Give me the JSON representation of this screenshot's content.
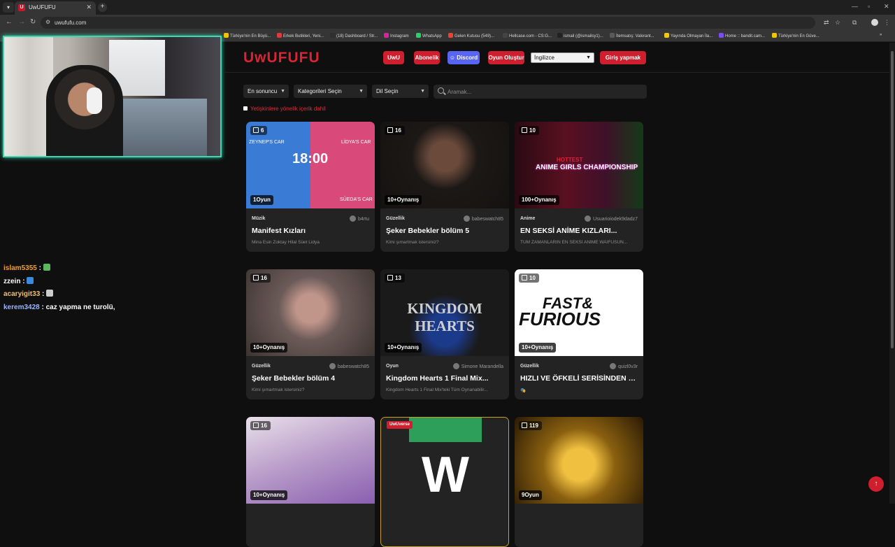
{
  "browser": {
    "tab_title": "UwUFUFU",
    "tab_favicon": "U",
    "url": "uwufufu.com",
    "bookmarks": [
      {
        "label": "Türkiye'nin En Büyü...",
        "color": "#f2c400"
      },
      {
        "label": "Erkek Butikleri, Yeni...",
        "color": "#e03a3a"
      },
      {
        "label": "(18) Dashboard / Str...",
        "color": "#2f2f2f"
      },
      {
        "label": "Instagram",
        "color": "#d6249f"
      },
      {
        "label": "WhatsApp",
        "color": "#25d366"
      },
      {
        "label": "Gelen Kutusu (549)...",
        "color": "#ea4335"
      },
      {
        "label": "Hellcase.com - CS:G...",
        "color": "#444444"
      },
      {
        "label": "ismail (@ismailsy1)...",
        "color": "#222222"
      },
      {
        "label": "İtemsatış: Valorant...",
        "color": "#5a5a5a"
      },
      {
        "label": "Yayında Olmayan İlа...",
        "color": "#f0c419"
      },
      {
        "label": "Home :: bandit.cam...",
        "color": "#7a4df0"
      },
      {
        "label": "Türkiye'nin En Güve...",
        "color": "#f2c400"
      }
    ]
  },
  "chat": [
    {
      "user": "islam5355",
      "color": "#f0a030",
      "message": ""
    },
    {
      "user": "zzein",
      "color": "#ffffff",
      "message": ""
    },
    {
      "user": "acaryigit33",
      "color": "#f0c070",
      "message": ""
    },
    {
      "user": "kerem3428",
      "color": "#9ab4ff",
      "message": "caz yapma ne turolü,"
    }
  ],
  "header": {
    "logo": "UwUFUFU",
    "buttons": [
      "UwU",
      "Abonelik",
      "Discord",
      "Oyun Oluştur"
    ],
    "language": "İngilizce",
    "login": "Giriş yapmak"
  },
  "filters": {
    "sort": "En sonuncu",
    "category": "Kategorileri Seçin",
    "language": "Dil Seçin",
    "search_placeholder": "Aramak..."
  },
  "nsfw_label": "Yetişkinlere yönelik içerik dahil",
  "cards": [
    {
      "count": "6",
      "plays": "1Oyun",
      "category": "Müzik",
      "author": "b4rtu",
      "title": "Manifest Kızları",
      "desc": "Mina Esin Zoktay Hilal Süet Lidya",
      "thumb": "#3a7bd5"
    },
    {
      "count": "16",
      "plays": "10+Oynanış",
      "category": "Güzellik",
      "author": "babeswatch85",
      "title": "Şeker Bebekler bölüm 5",
      "desc": "Kimi şımartmak istersiniz?",
      "thumb": "#2b2622"
    },
    {
      "count": "10",
      "plays": "100+Oynanış",
      "category": "Anime",
      "author": "Usuarioiodek9dadz7",
      "title": "EN SEKSİ ANİME KIZLARI...",
      "desc": "TÜM ZAMANLARIN EN SEKSİ ANİME WAİFUSUN...",
      "thumb": "#5a1020"
    },
    {
      "count": "16",
      "plays": "10+Oynanış",
      "category": "Güzellik",
      "author": "babeswatch85",
      "title": "Şeker Bebekler bölüm 4",
      "desc": "Kimi şımartmak istersiniz?",
      "thumb": "#6b5a58"
    },
    {
      "count": "13",
      "plays": "10+Oynanış",
      "category": "Oyun",
      "author": "Simone Marandella",
      "title": "Kingdom Hearts 1 Final Mix...",
      "desc": "Kingdom Hearts 1 Final Mix'teki Tüm Oynanabilir...",
      "thumb": "#1a1a1a"
    },
    {
      "count": "10",
      "plays": "10+Oynanış",
      "category": "Güzellik",
      "author": "quizl0v3r",
      "title": "HIZLI VE ÖFKELİ SERİSİNDEN E...",
      "desc": "🎭",
      "thumb": "#ffffff"
    },
    {
      "count": "16",
      "plays": "10+Oynanış",
      "category": "",
      "author": "",
      "title": "",
      "desc": "",
      "thumb": "#b79ac8"
    },
    {
      "count": "",
      "plays": "",
      "category": "",
      "author": "",
      "title": "",
      "desc": "",
      "thumb": "#232323",
      "badge": "UwUverse"
    },
    {
      "count": "119",
      "plays": "9Oyun",
      "category": "",
      "author": "",
      "title": "",
      "desc": "",
      "thumb": "#3a2a08"
    }
  ],
  "thumb_texts": {
    "card1_timer": "18:00",
    "card1_left_caption": "ZEYNEP'S CAR",
    "card1_right_caption": "LİDYA'S CAR",
    "card1_bottom_caption": "SÜEDA'S CAR",
    "card3_top": "HOTTEST",
    "card3_main": "ANIME GIRLS CHAMPIONSHIP",
    "card5_logo": "KINGDOM HEARTS",
    "card6_line1": "FAST&",
    "card6_line2": "FURIOUS",
    "card8_letter": "W"
  }
}
